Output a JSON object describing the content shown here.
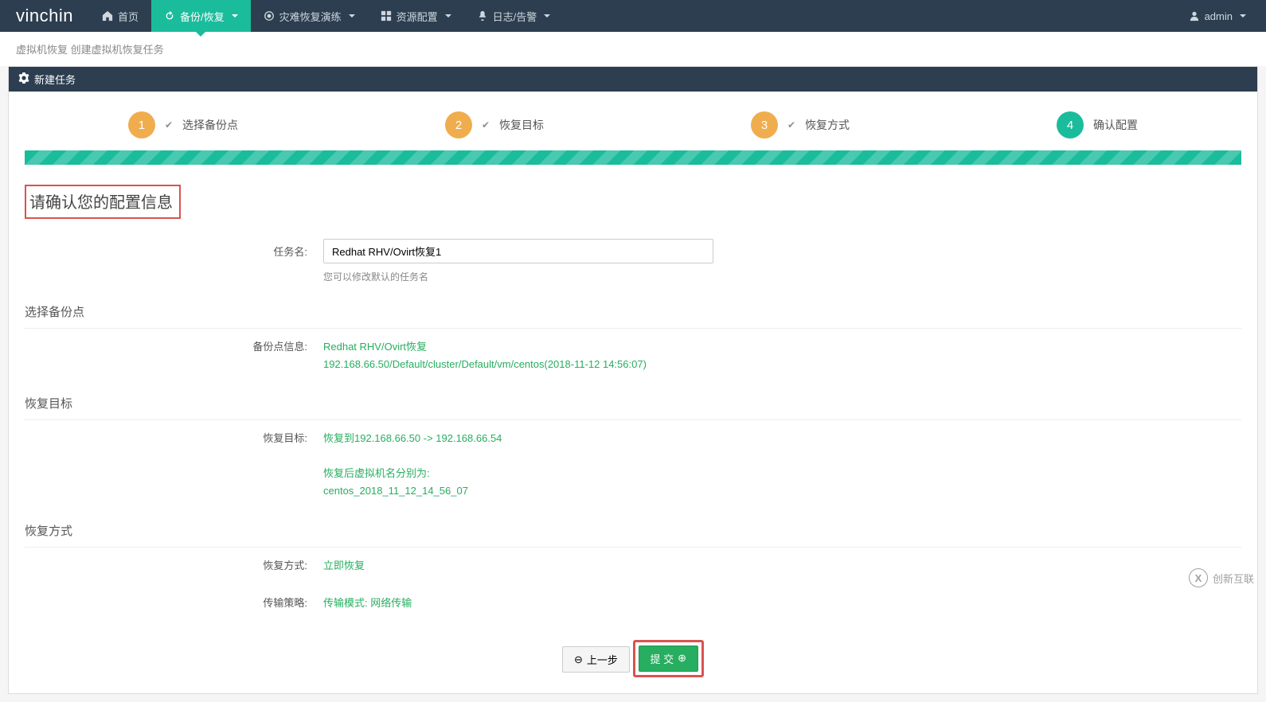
{
  "brand": "vinchin",
  "nav": {
    "home": "首页",
    "backup": "备份/恢复",
    "drill": "灾难恢复演练",
    "resource": "资源配置",
    "log": "日志/告警"
  },
  "user": "admin",
  "breadcrumb": "虚拟机恢复 创建虚拟机恢复任务",
  "panel_title": "新建任务",
  "steps": {
    "s1": "选择备份点",
    "s2": "恢复目标",
    "s3": "恢复方式",
    "s4": "确认配置"
  },
  "confirm_heading": "请确认您的配置信息",
  "form": {
    "task_name_label": "任务名:",
    "task_name_value": "Redhat RHV/Ovirt恢复1",
    "task_name_help": "您可以修改默认的任务名"
  },
  "sections": {
    "backup_point": "选择备份点",
    "restore_target": "恢复目标",
    "restore_method": "恢复方式"
  },
  "summary": {
    "backup_info_label": "备份点信息:",
    "backup_info_line1": "Redhat RHV/Ovirt恢复",
    "backup_info_line2": "192.168.66.50/Default/cluster/Default/vm/centos(2018-11-12 14:56:07)",
    "restore_target_label": "恢复目标:",
    "restore_target_line1": "恢复到192.168.66.50 -> 192.168.66.54",
    "restore_target_line2": "恢复后虚拟机名分别为:",
    "restore_target_line3": "centos_2018_11_12_14_56_07",
    "restore_method_label": "恢复方式:",
    "restore_method_value": "立即恢复",
    "transfer_label": "传输策略:",
    "transfer_value": "传输模式: 网络传输"
  },
  "buttons": {
    "prev": "上一步",
    "submit": "提 交"
  },
  "watermark": "创新互联"
}
